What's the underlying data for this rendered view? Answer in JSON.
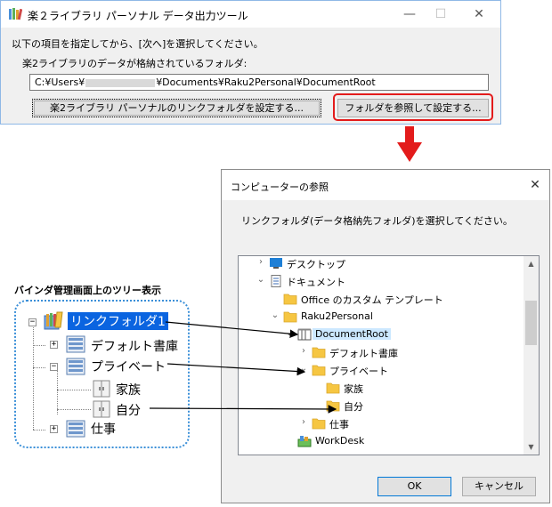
{
  "main_window": {
    "title": "楽２ライブラリ パーソナル データ出力ツール",
    "prompt": "以下の項目を指定してから、[次へ]を選択してください。",
    "folder_label": "楽2ライブラリのデータが格納されているフォルダ:",
    "path_prefix": "C:¥Users¥",
    "path_suffix": "¥Documents¥Raku2Personal¥DocumentRoot",
    "link_button_label": "楽2ライブラリ パーソナルのリンクフォルダを設定する...",
    "browse_button_label": "フォルダを参照して設定する..."
  },
  "browse_dialog": {
    "title": "コンピューターの参照",
    "prompt": "リンクフォルダ(データ格納先フォルダ)を選択してください。",
    "tree": [
      {
        "label": "デスクトップ",
        "chevron": "›",
        "icon": "desktop"
      },
      {
        "label": "ドキュメント",
        "chevron": "⌄",
        "icon": "document"
      },
      {
        "label": "Office のカスタム テンプレート",
        "chevron": "",
        "icon": "folder"
      },
      {
        "label": "Raku2Personal",
        "chevron": "⌄",
        "icon": "folder"
      },
      {
        "label": "DocumentRoot",
        "chevron": "⌄",
        "icon": "binder-root"
      },
      {
        "label": "デフォルト書庫",
        "chevron": "›",
        "icon": "folder"
      },
      {
        "label": "プライベート",
        "chevron": "⌄",
        "icon": "folder"
      },
      {
        "label": "家族",
        "chevron": "",
        "icon": "folder"
      },
      {
        "label": "自分",
        "chevron": "",
        "icon": "folder"
      },
      {
        "label": "仕事",
        "chevron": "›",
        "icon": "folder"
      },
      {
        "label": "WorkDesk",
        "chevron": "",
        "icon": "workdesk"
      }
    ],
    "ok_label": "OK",
    "cancel_label": "キャンセル"
  },
  "binder_panel": {
    "caption": "バインダ管理画面上のツリー表示",
    "root": "リンクフォルダ1",
    "items": [
      {
        "label": "デフォルト書庫",
        "expander": "+"
      },
      {
        "label": "プライベート",
        "expander": "−"
      },
      {
        "label": "家族",
        "expander": ""
      },
      {
        "label": "自分",
        "expander": ""
      },
      {
        "label": "仕事",
        "expander": "+"
      }
    ],
    "root_expander": "−"
  },
  "colors": {
    "highlight_red": "#e31b1b",
    "selection_blue": "#0a64e0",
    "folder_yellow": "#f6c642",
    "panel_border": "#3a8fd8"
  },
  "window_controls": {
    "minimize": "—",
    "maximize": "☐",
    "close": "✕"
  }
}
